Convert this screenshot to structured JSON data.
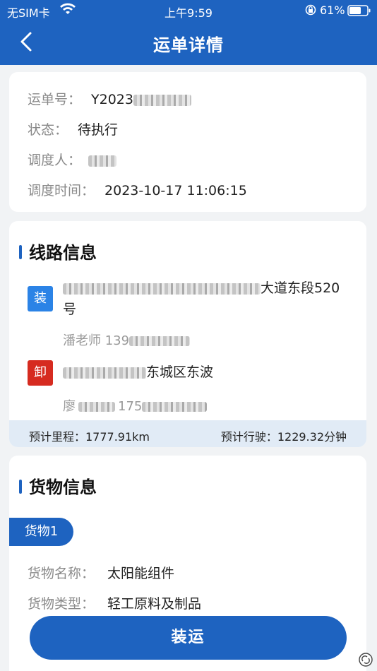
{
  "status_bar": {
    "carrier": "无SIM卡",
    "time": "上午9:59",
    "battery": "61%"
  },
  "nav": {
    "title": "运单详情"
  },
  "waybill": {
    "number_label": "运单号：",
    "number_value": "Y2023",
    "status_label": "状态：",
    "status_value": "待执行",
    "dispatcher_label": "调度人：",
    "dispatch_time_label": "调度时间：",
    "dispatch_time_value": "2023-10-17 11:06:15"
  },
  "route": {
    "title": "线路信息",
    "load_tag": "装",
    "load_address_tail": "大道东段520",
    "load_address_line2": "号",
    "load_contact_name": "潘老师",
    "load_contact_phone": "139",
    "unload_tag": "卸",
    "unload_address_tail": "东城区东波",
    "unload_contact_name": "廖",
    "unload_contact_phone": "175",
    "distance": "预计里程：1777.91km",
    "duration": "预计行驶：1229.32分钟"
  },
  "cargo": {
    "title": "货物信息",
    "tab": "货物1",
    "name_label": "货物名称：",
    "name_value": "太阳能组件",
    "type_label": "货物类型：",
    "type_value": "轻工原料及制品"
  },
  "action": {
    "ship_button": "装运"
  },
  "colors": {
    "primary": "#1e63c0",
    "load_tag": "#2b83e6",
    "unload_tag": "#d62b20"
  }
}
